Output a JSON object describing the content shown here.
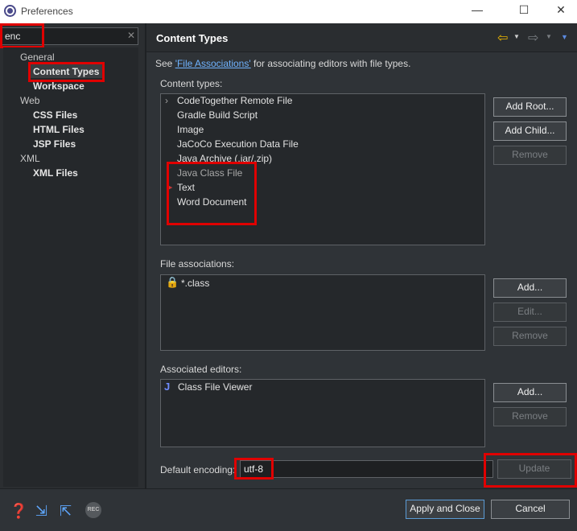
{
  "window": {
    "title": "Preferences"
  },
  "filter": {
    "value": "enc",
    "clear_glyph": "✕"
  },
  "tree": {
    "items": [
      {
        "label": "General",
        "kind": "cat"
      },
      {
        "label": "Content Types",
        "kind": "leaf"
      },
      {
        "label": "Workspace",
        "kind": "leaf"
      },
      {
        "label": "Web",
        "kind": "cat"
      },
      {
        "label": "CSS Files",
        "kind": "leaf"
      },
      {
        "label": "HTML Files",
        "kind": "leaf"
      },
      {
        "label": "JSP Files",
        "kind": "leaf"
      },
      {
        "label": "XML",
        "kind": "cat"
      },
      {
        "label": "XML Files",
        "kind": "leaf"
      }
    ]
  },
  "page": {
    "title": "Content Types",
    "see_prefix": "See ",
    "see_link": "'File Associations'",
    "see_suffix": " for associating editors with file types."
  },
  "content_types": {
    "label": "Content types:",
    "items": [
      "CodeTogether Remote File",
      "Gradle Build Script",
      "Image",
      "JaCoCo Execution Data File",
      "Java Archive (.jar/.zip)",
      "Java Class File",
      "Text",
      "Word Document"
    ],
    "buttons": {
      "add_root": "Add Root...",
      "add_child": "Add Child...",
      "remove": "Remove"
    }
  },
  "file_associations": {
    "label": "File associations:",
    "items": [
      "*.class"
    ],
    "buttons": {
      "add": "Add...",
      "edit": "Edit...",
      "remove": "Remove"
    }
  },
  "associated_editors": {
    "label": "Associated editors:",
    "items": [
      "Class File Viewer"
    ],
    "buttons": {
      "add": "Add...",
      "remove": "Remove"
    }
  },
  "encoding": {
    "label": "Default encoding:",
    "value": "utf-8",
    "update": "Update"
  },
  "footer": {
    "apply_close": "Apply and Close",
    "cancel": "Cancel",
    "rec": "REC"
  },
  "colors": {
    "accent_link": "#6fb3ff",
    "highlight": "#e00000",
    "nav_arrow": "#e8b400"
  }
}
